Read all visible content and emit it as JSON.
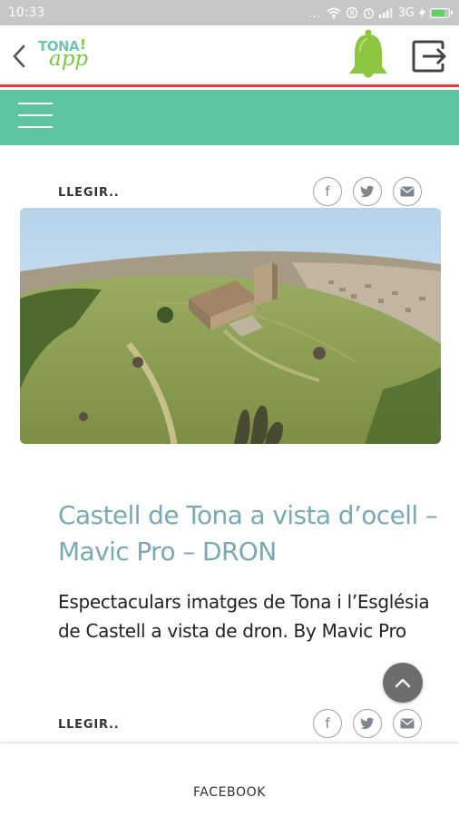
{
  "status_bar": {
    "time": "10:33",
    "dots": "...",
    "network": "3G",
    "battery_level": 0.85,
    "battery_color": "#5fd35f"
  },
  "app_bar": {
    "logo_text_top": "TONA",
    "logo_exclaim": "!",
    "logo_text_bottom": "app",
    "icons": {
      "back": "chevron-left-icon",
      "notifications": "bell-icon",
      "logout": "logout-icon"
    },
    "bell_color": "#8cc63f",
    "accent_color": "#e23b3b"
  },
  "menu_bar": {
    "color": "#5ec4a2",
    "icon": "hamburger-icon"
  },
  "article": {
    "read_more": "LLEGIR..",
    "share_icons": [
      "facebook-icon",
      "twitter-icon",
      "email-icon"
    ],
    "share_glyphs": {
      "facebook": "f",
      "twitter": "t",
      "email": "✉"
    },
    "title": "Castell de Tona a vista d’ocell – Mavic Pro – DRON",
    "description": "Espectaculars imatges de Tona i l’Església de Castell a vista de dron. By Mavic Pro"
  },
  "next_article": {
    "read_more": "LLEGIR..",
    "share_icons": [
      "facebook-icon",
      "twitter-icon",
      "email-icon"
    ]
  },
  "bottom_nav": {
    "tab_label": "FACEBOOK"
  }
}
